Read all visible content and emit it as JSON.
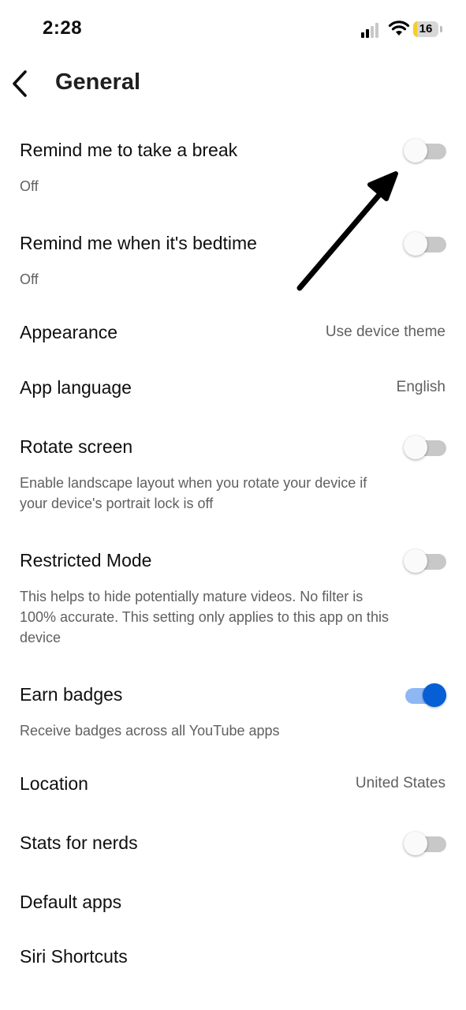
{
  "status_bar": {
    "time": "2:28",
    "battery": "16",
    "battery_level": 0.16
  },
  "header": {
    "title": "General",
    "back_icon": "chevron-left-icon"
  },
  "settings": {
    "break_reminder": {
      "label": "Remind me to take a break",
      "sub": "Off",
      "enabled": false
    },
    "bedtime_reminder": {
      "label": "Remind me when it's bedtime",
      "sub": "Off",
      "enabled": false
    },
    "appearance": {
      "label": "Appearance",
      "value": "Use device theme"
    },
    "app_language": {
      "label": "App language",
      "value": "English"
    },
    "rotate_screen": {
      "label": "Rotate screen",
      "sub": "Enable landscape layout when you rotate your device if your device's portrait lock is off",
      "enabled": false
    },
    "restricted_mode": {
      "label": "Restricted Mode",
      "sub": "This helps to hide potentially mature videos. No filter is 100% accurate. This setting only applies to this app on this device",
      "enabled": false
    },
    "earn_badges": {
      "label": "Earn badges",
      "sub": "Receive badges across all YouTube apps",
      "enabled": true
    },
    "location": {
      "label": "Location",
      "value": "United States"
    },
    "stats_for_nerds": {
      "label": "Stats for nerds",
      "enabled": false
    },
    "default_apps": {
      "label": "Default apps"
    },
    "siri_shortcuts": {
      "label": "Siri Shortcuts"
    }
  },
  "colors": {
    "accent": "#065fd4",
    "track_on": "#8eb8f4",
    "track_off": "#c8c8c8",
    "secondary_text": "#606060"
  },
  "annotation": {
    "icon": "arrow-annotation-icon"
  }
}
